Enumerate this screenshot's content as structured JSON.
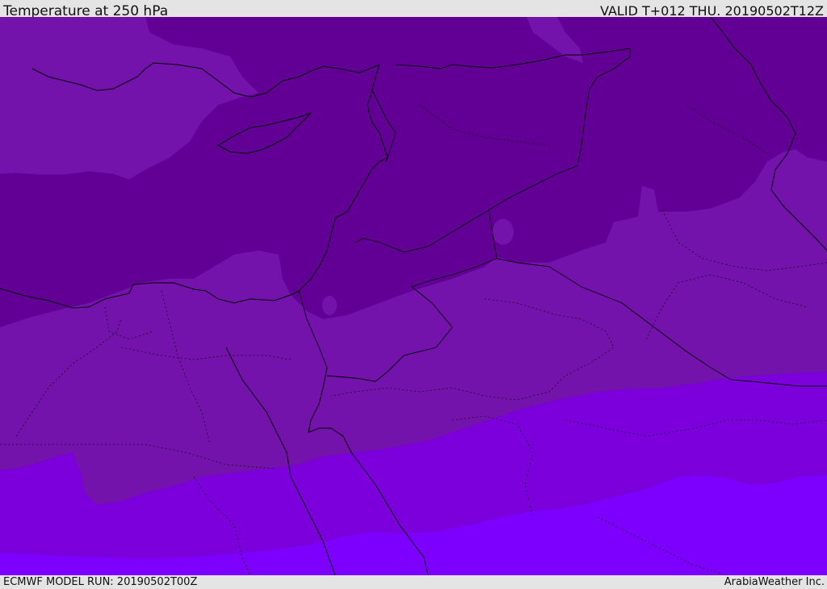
{
  "header": {
    "title": "Temperature at 250 hPa",
    "valid": "VALID T+012 THU. 20190502T12Z"
  },
  "footer": {
    "model_run": "ECMWF MODEL RUN: 20190502T00Z",
    "credit": "ArabiaWeather Inc."
  },
  "colors": {
    "band_darkest": "#620096",
    "band_mid": "#7412ac",
    "band_light": "#7c00dc",
    "band_lightest": "#7d00fe",
    "coastline": "#000000",
    "border": "#1a0030",
    "frame": "#e4e4e4"
  }
}
